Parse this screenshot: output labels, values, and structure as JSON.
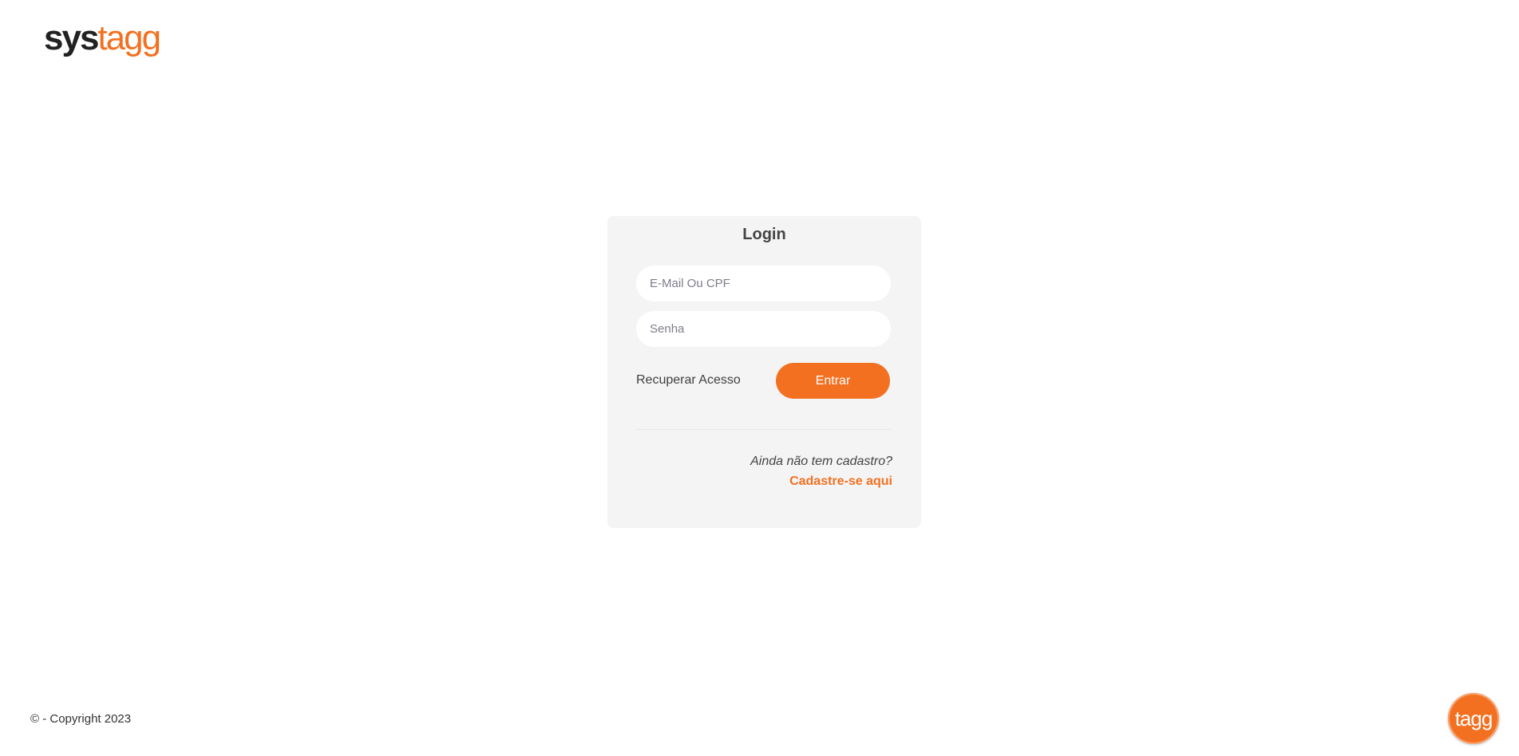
{
  "header": {
    "logo": {
      "part1": "sys",
      "part2": "tagg"
    }
  },
  "login_card": {
    "title": "Login",
    "email_placeholder": "E-Mail Ou CPF",
    "password_placeholder": "Senha",
    "recover_label": "Recuperar Acesso",
    "submit_label": "Entrar",
    "signup_question": "Ainda não tem cadastro?",
    "signup_link": "Cadastre-se aqui"
  },
  "footer": {
    "copyright": "© - Copyright 2023",
    "badge": {
      "text": "tagg",
      "icon": "tagg-logo-icon"
    }
  },
  "colors": {
    "accent": "#f37021",
    "card_background": "#f4f4f4",
    "text": "#333333"
  }
}
